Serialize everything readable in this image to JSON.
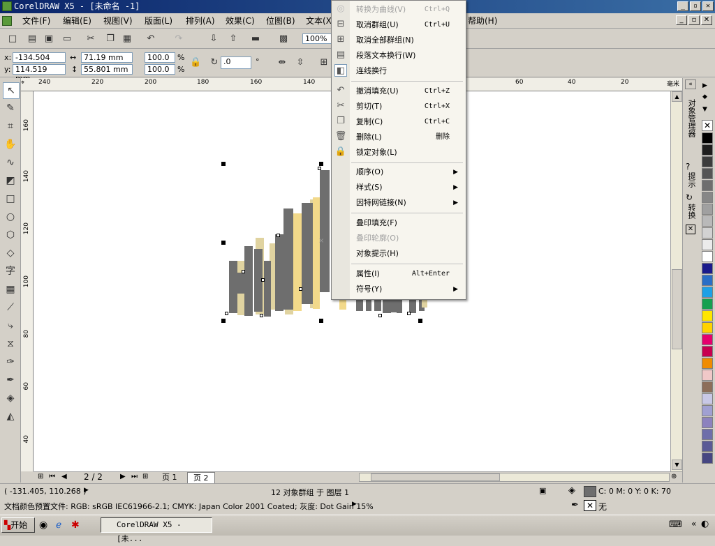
{
  "window": {
    "title": "CorelDRAW X5 - [未命名 -1]"
  },
  "menubar": {
    "items": [
      "文件(F)",
      "编辑(E)",
      "视图(V)",
      "版面(L)",
      "排列(A)",
      "效果(C)",
      "位图(B)",
      "文本(X)",
      "帮助(H)"
    ]
  },
  "toolbar": {
    "zoom": "100%"
  },
  "props": {
    "x_label": "x:",
    "x": "-134.504 mm",
    "y_label": "y:",
    "y": "114.519 mm",
    "w": "71.19 mm",
    "h": "55.801 mm",
    "sx": "100.0",
    "sy": "100.0",
    "pct": "%",
    "rotation": ".0",
    "deg": "°"
  },
  "ruler": {
    "h_ticks": [
      "240",
      "220",
      "200",
      "180",
      "160",
      "140",
      "60",
      "40",
      "20"
    ],
    "h_unit": "毫米",
    "v_ticks": [
      "160",
      "140",
      "120",
      "100",
      "80",
      "60",
      "40"
    ]
  },
  "context_menu": {
    "items": [
      {
        "label": "转换为曲线(V)",
        "shortcut": "Ctrl+Q",
        "disabled": true
      },
      {
        "label": "取消群组(U)",
        "shortcut": "Ctrl+U"
      },
      {
        "label": "取消全部群组(N)",
        "shortcut": ""
      },
      {
        "label": "段落文本换行(W)",
        "shortcut": ""
      },
      {
        "label": "连线换行",
        "shortcut": ""
      },
      {
        "label": "撤消填充(U)",
        "shortcut": "Ctrl+Z"
      },
      {
        "label": "剪切(T)",
        "shortcut": "Ctrl+X"
      },
      {
        "label": "复制(C)",
        "shortcut": "Ctrl+C"
      },
      {
        "label": "删除(L)",
        "shortcut": "删除"
      },
      {
        "label": "锁定对象(L)",
        "shortcut": ""
      },
      {
        "label": "顺序(O)",
        "submenu": true
      },
      {
        "label": "样式(S)",
        "submenu": true
      },
      {
        "label": "因特网链接(N)",
        "submenu": true
      },
      {
        "label": "叠印填充(F)",
        "shortcut": ""
      },
      {
        "label": "叠印轮廓(O)",
        "shortcut": "",
        "disabled": true
      },
      {
        "label": "对象提示(H)",
        "shortcut": ""
      },
      {
        "label": "属性(I)",
        "shortcut": "Alt+Enter"
      },
      {
        "label": "符号(Y)",
        "submenu": true
      }
    ]
  },
  "pages": {
    "counter": "2 / 2",
    "tab1": "页 1",
    "tab2": "页 2"
  },
  "dock": {
    "tab1": "对象管理器",
    "tab2": "提示",
    "tab3": "转换"
  },
  "status": {
    "coords": "( -131.405, 110.268 )",
    "selection": "12 对象群组 于 图层 1",
    "fill": "C: 0 M: 0 Y: 0 K: 70",
    "outline": "无",
    "profile": "文档颜色预置文件: RGB: sRGB IEC61966-2.1; CMYK: Japan Color 2001 Coated; 灰度: Dot Gain 15%"
  },
  "taskbar": {
    "start": "开始",
    "task": "CorelDRAW X5 - [未..."
  },
  "colors": {
    "gray": "#6e6e6e",
    "tan": "#e0d3a0",
    "yellow": "#f2d98a",
    "title": "#0a246a"
  },
  "palette": [
    "#000000",
    "#1e1e1e",
    "#3c3c3c",
    "#555555",
    "#6e6e6e",
    "#878787",
    "#a0a0a0",
    "#b9b9b9",
    "#d2d2d2",
    "#ebebeb",
    "#ffffff",
    "#1a1a8c",
    "#2a6ec6",
    "#1ea0e6",
    "#16a050",
    "#ffe600",
    "#ffd200",
    "#e6006e",
    "#c80050",
    "#f08c00",
    "#f0c8c8",
    "#8c6e5a",
    "#c8c8e6",
    "#a0a0d2",
    "#8c82be",
    "#6e6eaa",
    "#5a5a96",
    "#464682"
  ]
}
